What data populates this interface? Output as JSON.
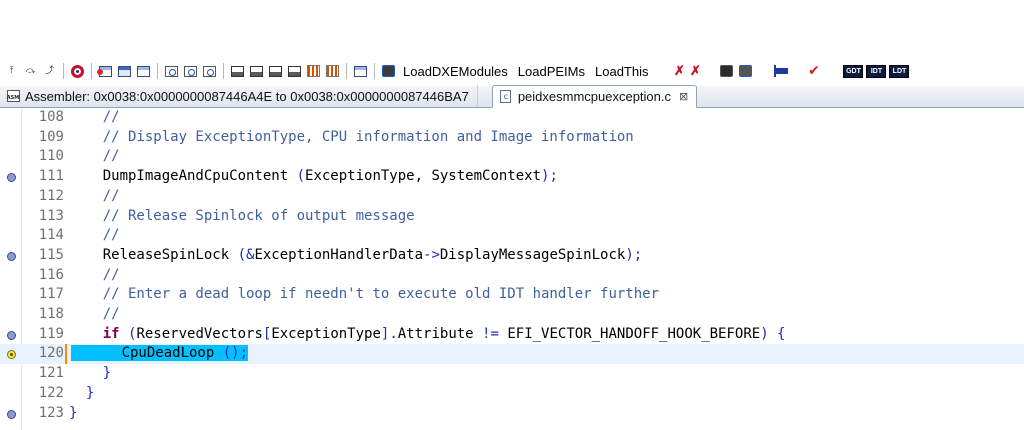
{
  "toolbar": {
    "text_buttons": [
      "LoadDXEModules",
      "LoadPEIMs",
      "LoadThis"
    ],
    "icons": [
      "step-into-icon",
      "step-over-icon",
      "step-out-icon",
      "target-icon",
      "window-red-icon",
      "window-icon",
      "window-check-icon",
      "find-icon",
      "find-next-icon",
      "find-prev-icon",
      "disk-icon",
      "disk-plus-icon",
      "disk-minus-icon",
      "disk-list-icon",
      "bars-icon",
      "bars-blue-icon",
      "window-edit-icon",
      "chip-icon",
      "red-x-icon",
      "gpu-icon",
      "blue-flag-icon",
      "check-icon",
      "gdt-icon",
      "idt-icon",
      "ldt-icon"
    ],
    "gdt_label": "GDT",
    "idt_label": "IDT",
    "ldt_label": "LDT"
  },
  "tabs": [
    {
      "label": "Assembler: 0x0038:0x0000000087446A4E to 0x0038:0x0000000087446BA7",
      "active": false
    },
    {
      "label": "peidxesmmcpuexception.c",
      "active": true,
      "close": "⊠"
    }
  ],
  "editor": {
    "lines": [
      {
        "num": "108",
        "marker": false,
        "current": false,
        "parts": [
          {
            "t": "    //",
            "c": "comment"
          }
        ]
      },
      {
        "num": "109",
        "marker": false,
        "current": false,
        "parts": [
          {
            "t": "    // Display ExceptionType, CPU information and Image information",
            "c": "comment"
          }
        ]
      },
      {
        "num": "110",
        "marker": false,
        "current": false,
        "parts": [
          {
            "t": "    //",
            "c": "comment"
          }
        ]
      },
      {
        "num": "111",
        "marker": true,
        "current": false,
        "parts": [
          {
            "t": "    DumpImageAndCpuContent ",
            "c": "plain"
          },
          {
            "t": "(",
            "c": "op"
          },
          {
            "t": "ExceptionType, SystemContext",
            "c": "plain"
          },
          {
            "t": ");",
            "c": "op"
          }
        ]
      },
      {
        "num": "112",
        "marker": false,
        "current": false,
        "parts": [
          {
            "t": "    //",
            "c": "comment"
          }
        ]
      },
      {
        "num": "113",
        "marker": false,
        "current": false,
        "parts": [
          {
            "t": "    // Release Spinlock of output message",
            "c": "comment"
          }
        ]
      },
      {
        "num": "114",
        "marker": false,
        "current": false,
        "parts": [
          {
            "t": "    //",
            "c": "comment"
          }
        ]
      },
      {
        "num": "115",
        "marker": true,
        "current": false,
        "parts": [
          {
            "t": "    ReleaseSpinLock ",
            "c": "plain"
          },
          {
            "t": "(&",
            "c": "op"
          },
          {
            "t": "ExceptionHandlerData",
            "c": "plain"
          },
          {
            "t": "->",
            "c": "op"
          },
          {
            "t": "DisplayMessageSpinLock",
            "c": "plain"
          },
          {
            "t": ");",
            "c": "op"
          }
        ]
      },
      {
        "num": "116",
        "marker": false,
        "current": false,
        "parts": [
          {
            "t": "    //",
            "c": "comment"
          }
        ]
      },
      {
        "num": "117",
        "marker": false,
        "current": false,
        "parts": [
          {
            "t": "    // Enter a dead loop if needn't to execute old IDT handler further",
            "c": "comment"
          }
        ]
      },
      {
        "num": "118",
        "marker": false,
        "current": false,
        "parts": [
          {
            "t": "    //",
            "c": "comment"
          }
        ]
      },
      {
        "num": "119",
        "marker": true,
        "current": false,
        "parts": [
          {
            "t": "    ",
            "c": "plain"
          },
          {
            "t": "if",
            "c": "kw"
          },
          {
            "t": " (",
            "c": "op"
          },
          {
            "t": "ReservedVectors",
            "c": "plain"
          },
          {
            "t": "[",
            "c": "op"
          },
          {
            "t": "ExceptionType",
            "c": "plain"
          },
          {
            "t": "].",
            "c": "op"
          },
          {
            "t": "Attribute ",
            "c": "plain"
          },
          {
            "t": "!=",
            "c": "op"
          },
          {
            "t": " EFI_VECTOR_HANDOFF_HOOK_BEFORE",
            "c": "plain"
          },
          {
            "t": ") {",
            "c": "op"
          }
        ]
      },
      {
        "num": "120",
        "marker": true,
        "current": true,
        "parts": [
          {
            "t": "      CpuDeadLoop ",
            "c": "hl-plain"
          },
          {
            "t": "();",
            "c": "hl-op"
          }
        ]
      },
      {
        "num": "121",
        "marker": false,
        "current": false,
        "parts": [
          {
            "t": "    }",
            "c": "op"
          }
        ]
      },
      {
        "num": "122",
        "marker": false,
        "current": false,
        "parts": [
          {
            "t": "  }",
            "c": "op"
          }
        ]
      },
      {
        "num": "123",
        "marker": true,
        "current": false,
        "parts": [
          {
            "t": "}",
            "c": "op"
          }
        ]
      }
    ]
  }
}
